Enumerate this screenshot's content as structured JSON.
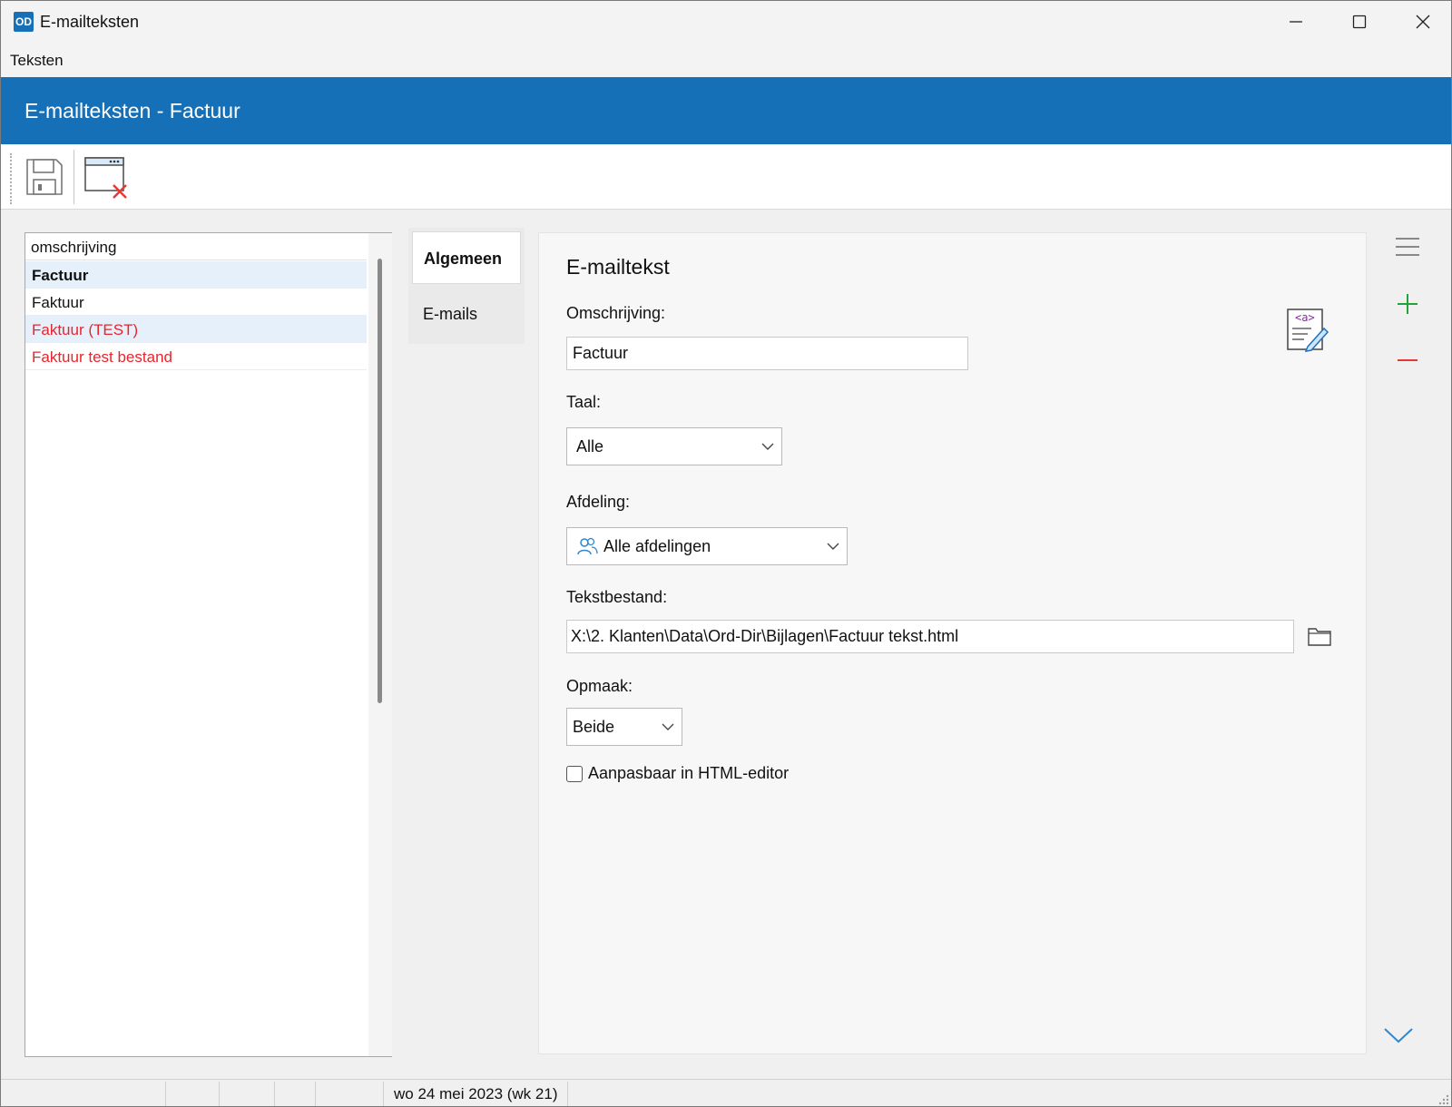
{
  "window": {
    "title": "E-mailteksten",
    "logo_text": "OD"
  },
  "menu": {
    "items": [
      "Teksten"
    ]
  },
  "header": {
    "title": "E-mailteksten - Factuur"
  },
  "toolbar": {
    "buttons": [
      "save-icon",
      "close-window-icon"
    ]
  },
  "list": {
    "column_header": "omschrijving",
    "rows": [
      {
        "label": "Factuur",
        "selected": true,
        "color": "#111111"
      },
      {
        "label": "Faktuur",
        "selected": false,
        "color": "#111111"
      },
      {
        "label": "Faktuur (TEST)",
        "selected": false,
        "color": "#e8242c"
      },
      {
        "label": "Faktuur test bestand",
        "selected": false,
        "color": "#e8242c"
      }
    ]
  },
  "tabs": [
    {
      "label": "Algemeen",
      "active": true
    },
    {
      "label": "E-mails",
      "active": false
    }
  ],
  "form": {
    "title": "E-mailtekst",
    "omschrijving": {
      "label": "Omschrijving:",
      "value": "Factuur"
    },
    "taal": {
      "label": "Taal:",
      "value": "Alle"
    },
    "afdeling": {
      "label": "Afdeling:",
      "value": "Alle afdelingen"
    },
    "tekstbestand": {
      "label": "Tekstbestand:",
      "value": "X:\\2. Klanten\\Data\\Ord-Dir\\Bijlagen\\Factuur tekst.html"
    },
    "opmaak": {
      "label": "Opmaak:",
      "value": "Beide"
    },
    "html_editor": {
      "label": "Aanpasbaar in HTML-editor",
      "checked": false
    }
  },
  "statusbar": {
    "date": "wo 24 mei 2023 (wk 21)"
  },
  "colors": {
    "accent": "#1570b8",
    "error_text": "#e8242c",
    "add": "#22a33a",
    "remove": "#e23a3a"
  }
}
